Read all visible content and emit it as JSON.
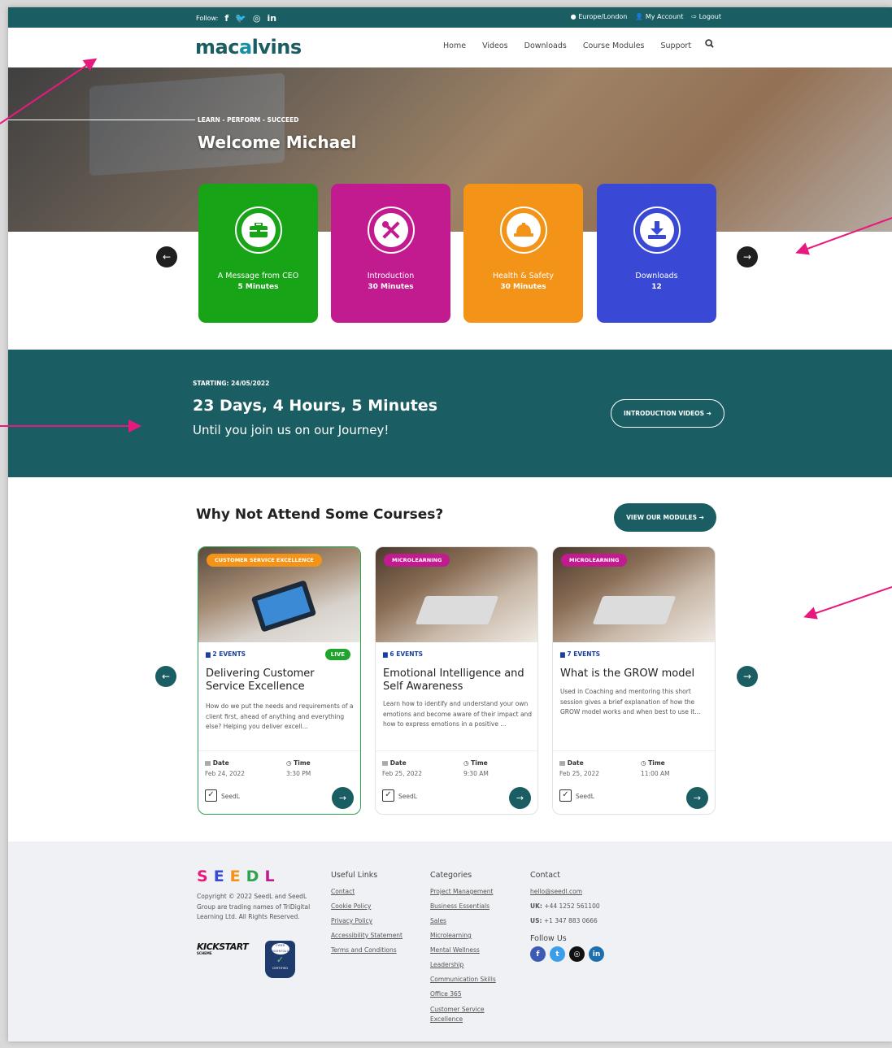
{
  "topbar": {
    "follow_label": "Follow:",
    "timezone": "Europe/London",
    "account": "My Account",
    "logout": "Logout"
  },
  "nav": {
    "logo_part1": "mac",
    "logo_part2": "a",
    "logo_part3": "lvins",
    "items": [
      "Home",
      "Videos",
      "Downloads",
      "Course Modules",
      "Support"
    ]
  },
  "hero": {
    "eyebrow": "LEARN - PERFORM - SUCCEED",
    "welcome": "Welcome Michael"
  },
  "tiles": [
    {
      "title": "A Message from CEO",
      "sub": "5 Minutes",
      "color": "#17a417",
      "icon": "briefcase-icon"
    },
    {
      "title": "Introduction",
      "sub": "30 Minutes",
      "color": "#c21a8f",
      "icon": "tools-icon"
    },
    {
      "title": "Health & Safety",
      "sub": "30 Minutes",
      "color": "#f39418",
      "icon": "hardhat-icon"
    },
    {
      "title": "Downloads",
      "sub": "12",
      "color": "#3a48d6",
      "icon": "download-icon"
    }
  ],
  "countdown": {
    "starting": "STARTING: 24/05/2022",
    "time": "23 Days, 4 Hours, 5 Minutes",
    "until": "Until you join us on our Journey!",
    "button": "INTRODUCTION VIDEOS ➔"
  },
  "courses": {
    "title": "Why Not Attend Some Courses?",
    "button": "VIEW OUR MODULES ➔",
    "date_label": "Date",
    "time_label": "Time",
    "items": [
      {
        "tag": "CUSTOMER SERVICE EXCELLENCE",
        "tag_color": "#f39418",
        "events": "2 EVENTS",
        "live": "LIVE",
        "title": "Delivering Customer Service Excellence",
        "desc": "How do we put the needs and requirements of a client first, ahead of anything and everything else? Helping you deliver excell...",
        "date": "Feb 24, 2022",
        "time": "3:30 PM",
        "org": "SeedL"
      },
      {
        "tag": "MICROLEARNING",
        "tag_color": "#c21a8f",
        "events": "6 EVENTS",
        "title": "Emotional Intelligence and Self Awareness",
        "desc": "Learn how to identify and understand your own emotions and become aware of their impact and how to express emotions in a positive ...",
        "date": "Feb 25, 2022",
        "time": "9:30 AM",
        "org": "SeedL"
      },
      {
        "tag": "MICROLEARNING",
        "tag_color": "#c21a8f",
        "events": "7 EVENTS",
        "title": "What is the GROW model",
        "desc": "Used in Coaching and mentoring this short session gives a brief explanation of how the GROW model works and when best to use it...",
        "date": "Feb 25, 2022",
        "time": "11:00 AM",
        "org": "SeedL"
      }
    ]
  },
  "footer": {
    "brand": "SEEDL",
    "copyright": "Copyright © 2022 SeedL and SeedL Group are trading names of TriDigital Learning Ltd. All Rights Reserved.",
    "kickstart": "KICKSTART",
    "kickstart_sub": "SCHEME",
    "cyber_top": "CYBER ESSENTIALS",
    "cyber_bottom": "CERTIFIED",
    "useful_head": "Useful Links",
    "useful": [
      "Contact",
      "Cookie Policy",
      "Privacy Policy",
      "Accessibility Statement",
      "Terms and Conditions"
    ],
    "cat_head": "Categories",
    "categories": [
      "Project Management",
      "Business Essentials",
      "Sales",
      "Microlearning",
      "Mental Wellness",
      "Leadership",
      "Communication Skills",
      "Office 365",
      "Customer Service Excellence"
    ],
    "contact_head": "Contact",
    "email": "hello@seedl.com",
    "uk_label": "UK:",
    "uk_phone": "+44 1252 561100",
    "us_label": "US:",
    "us_phone": "+1 347 883 0666",
    "follow_head": "Follow Us"
  }
}
